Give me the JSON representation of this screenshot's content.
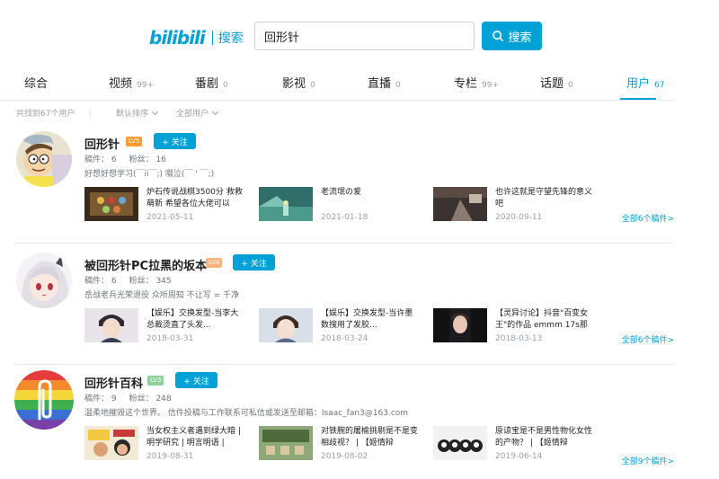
{
  "header": {
    "logo_text": "bilibili",
    "logo_sub": "搜索",
    "search_value": "回形针",
    "search_button": "搜索",
    "accent": "#00a1d6"
  },
  "tabs": [
    {
      "label": "综合",
      "count": ""
    },
    {
      "label": "视频",
      "count": "99+"
    },
    {
      "label": "番剧",
      "count": "0"
    },
    {
      "label": "影视",
      "count": "0"
    },
    {
      "label": "直播",
      "count": "0"
    },
    {
      "label": "专栏",
      "count": "99+"
    },
    {
      "label": "话题",
      "count": "0"
    },
    {
      "label": "用户",
      "count": "67",
      "active": true
    }
  ],
  "filter": {
    "result_count": "共找到67个用户",
    "sort": "默认排序",
    "type": "全部用户"
  },
  "users": [
    {
      "name": "回形针",
      "level": "LV5",
      "level_color": "#ff9b2f",
      "follow": "+ 关注",
      "stats": [
        "稿件： 6",
        "粉丝： 16"
      ],
      "sign": "好想好想学习(￣ii￣;) 啜泣(￣ ' ￣;)",
      "avatar_icon": "rick-and-morty-avatar",
      "videos": [
        {
          "title": "炉石传说战棋3500分 救救萌新 希望各位大佬可以",
          "date": "2021-05-11"
        },
        {
          "title": "老流氓の爱",
          "date": "2021-01-18"
        },
        {
          "title": "也许这就是守望先锋的意义吧",
          "date": "2020-09-11"
        }
      ],
      "more": "全部6个稿件>"
    },
    {
      "name": "被回形针PC拉黑的坂本",
      "level": "LV4",
      "level_color": "#ffb37c",
      "follow": "+ 关注",
      "stats": [
        "稿件： 6",
        "粉丝： 345"
      ],
      "sign": "岳战老兵光荣退役 众所周知 不让写 = 千净",
      "avatar_icon": "anime-girl-avatar",
      "videos": [
        {
          "title": "【娱乐】交换发型-当李大总裁烫直了头发...",
          "date": "2018-03-31"
        },
        {
          "title": "【娱乐】交换发型-当许墨数搜用了发胶...",
          "date": "2018-03-24"
        },
        {
          "title": "【灵异讨论】抖音\"百变女王\"的作品 emmm 17s那",
          "date": "2018-03-13"
        }
      ],
      "more": "全部6个稿件>"
    },
    {
      "name": "回形针百科",
      "level": "LV3",
      "level_color": "#8bd29b",
      "follow": "+ 关注",
      "stats": [
        "稿件： 9",
        "粉丝： 248"
      ],
      "sign": "温柔地摧毁这个世界。 信件投稿与工作联系可私信或发送至邮箱：Isaac_fan3@163.com",
      "avatar_icon": "rainbow-paperclip-avatar",
      "videos": [
        {
          "title": "当女权主义者遇到绿大暗 | 明学研究 | 明言明语 |",
          "date": "2019-08-31"
        },
        {
          "title": "对铁腕的屠榆挑剔是不是变相歧视？ | 【姬情辩",
          "date": "2019-08-02"
        },
        {
          "title": "原谅宝是不是男性物化女性的产物？ | 【姬情辩",
          "date": "2019-06-14"
        }
      ],
      "more": "全部9个稿件>"
    }
  ]
}
